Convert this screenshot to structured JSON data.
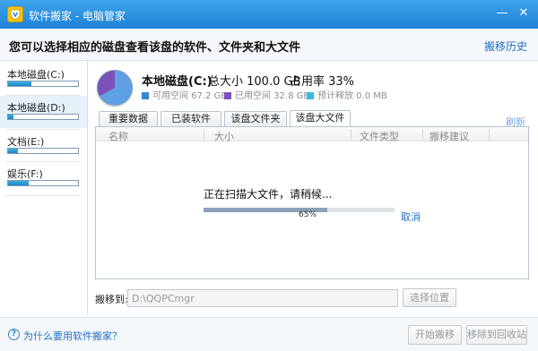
{
  "window": {
    "title": "软件搬家 - 电脑管家",
    "minimize_glyph": "—",
    "close_glyph": "✕"
  },
  "header": {
    "title": "您可以选择相应的磁盘查看该盘的软件、文件夹和大文件",
    "history_link": "搬移历史"
  },
  "sidebar": {
    "drives": [
      {
        "label": "本地磁盘(C:)",
        "fill": 0.33,
        "selected": false
      },
      {
        "label": "本地磁盘(D:)",
        "fill": 0.08,
        "selected": true
      },
      {
        "label": "文档(E:)",
        "fill": 0.14,
        "selected": false
      },
      {
        "label": "娱乐(F:)",
        "fill": 0.3,
        "selected": false
      }
    ]
  },
  "disk": {
    "name": "本地磁盘(C:)",
    "total": "总大小 100.0 GB",
    "usage": "占用率 33%",
    "legend": [
      {
        "text": "可用空间 67.2 GB",
        "color": "#3b86d1"
      },
      {
        "text": "已用空间 32.8 GB",
        "color": "#7c50b9"
      },
      {
        "text": "预计释放 0.0 MB",
        "color": "#3ab9d8"
      }
    ]
  },
  "tabs": [
    {
      "label": "重要数据",
      "active": false
    },
    {
      "label": "已装软件",
      "active": false
    },
    {
      "label": "该盘文件夹",
      "active": false
    },
    {
      "label": "该盘大文件",
      "active": true
    }
  ],
  "refresh_link": "刷新",
  "table": {
    "columns": [
      "名称",
      "大小",
      "文件类型",
      "搬移建议"
    ]
  },
  "scan": {
    "status_text": "正在扫描大文件，请稍候...",
    "progress": 0.65,
    "progress_label": "65%",
    "cancel_link": "取消"
  },
  "move_to": {
    "label": "搬移到:",
    "path": "D:\\QQPCmgr",
    "select_button": "选择位置"
  },
  "footer": {
    "help_glyph": "?",
    "help_link": "为什么要用软件搬家？",
    "start_button": "开始搬移",
    "recycle_button": "移除到回收站"
  }
}
